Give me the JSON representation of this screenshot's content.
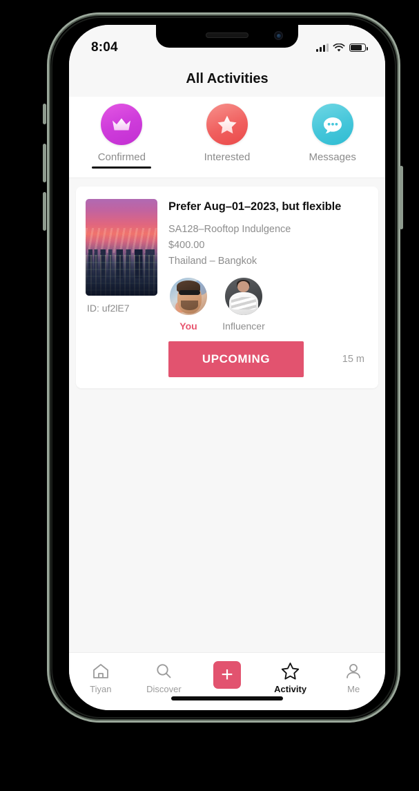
{
  "status_bar": {
    "time": "8:04",
    "signal_icon": "cellular-bars-icon",
    "wifi_icon": "wifi-icon",
    "battery_icon": "battery-icon"
  },
  "header": {
    "title": "All Activities"
  },
  "tabs": {
    "items": [
      {
        "label": "Confirmed",
        "icon": "crown-icon",
        "active": true,
        "color": "#cf3ddb"
      },
      {
        "label": "Interested",
        "icon": "star-filled-icon",
        "active": false,
        "color": "#f0605f"
      },
      {
        "label": "Messages",
        "icon": "chat-bubble-icon",
        "active": false,
        "color": "#45c6da"
      }
    ]
  },
  "activity_card": {
    "thumbnail_alt": "rooftop-sunset-cityscape",
    "id_label": "ID: uf2lE7",
    "title": "Prefer Aug–01–2023, but flexible",
    "package": "SA128–Rooftop Indulgence",
    "price": "$400.00",
    "location": "Thailand – Bangkok",
    "people": [
      {
        "label": "You",
        "avatar": "avatar-man-sunglasses",
        "highlight": true
      },
      {
        "label": "Influencer",
        "avatar": "avatar-woman-dress",
        "highlight": false
      }
    ],
    "status_button": "UPCOMING",
    "status_button_color": "#e2536f",
    "time_remaining": "15 m"
  },
  "bottom_nav": {
    "items": [
      {
        "label": "Tiyan",
        "icon": "home-icon",
        "active": false
      },
      {
        "label": "Discover",
        "icon": "search-icon",
        "active": false
      },
      {
        "label": "",
        "icon": "plus-icon",
        "active": false
      },
      {
        "label": "Activity",
        "icon": "star-outline-icon",
        "active": true
      },
      {
        "label": "Me",
        "icon": "person-icon",
        "active": false
      }
    ]
  }
}
